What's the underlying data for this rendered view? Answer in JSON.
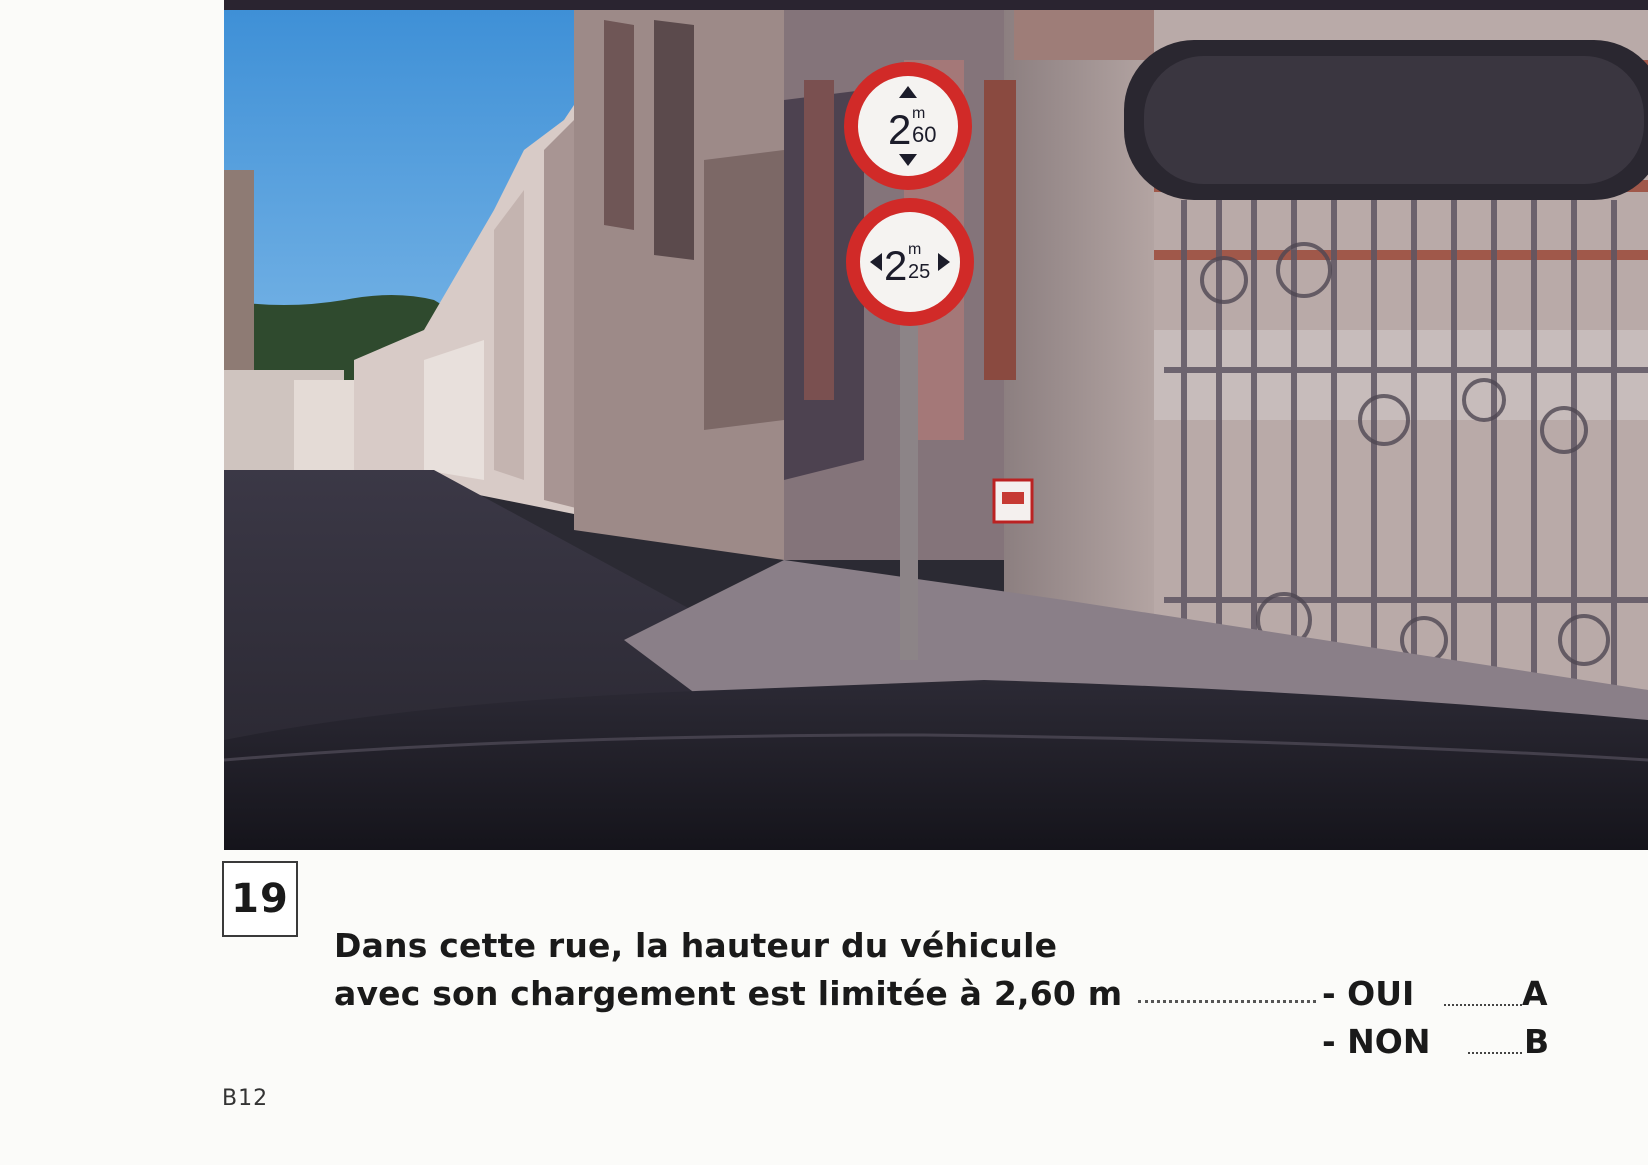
{
  "question": {
    "number": "19",
    "line1": "Dans cette rue, la hauteur du véhicule",
    "line2": "avec son chargement est limitée à 2,60 m"
  },
  "options": [
    {
      "label": "- OUI",
      "letter": "A"
    },
    {
      "label": "- NON",
      "letter": "B"
    }
  ],
  "page_code": "B12",
  "photo": {
    "signs": [
      {
        "value": "2",
        "unit": "m",
        "decimal": "60",
        "orientation": "vertical"
      },
      {
        "value": "2",
        "unit": "m",
        "decimal": "25",
        "orientation": "horizontal"
      }
    ]
  }
}
